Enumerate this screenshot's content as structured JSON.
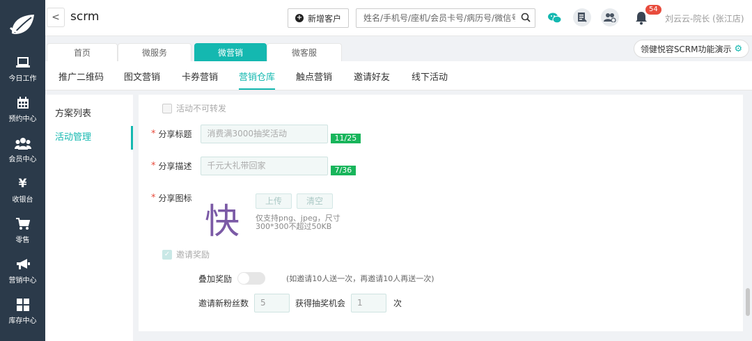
{
  "sidebar": {
    "logo_icon": "leaf-logo-icon",
    "items": [
      {
        "label": "今日工作",
        "icon": "laptop-icon"
      },
      {
        "label": "预约中心",
        "icon": "calendar-icon"
      },
      {
        "label": "会员中心",
        "icon": "users-icon"
      },
      {
        "label": "收银台",
        "icon": "yen-icon"
      },
      {
        "label": "零售",
        "icon": "cart-icon"
      },
      {
        "label": "营销中心",
        "icon": "megaphone-icon"
      },
      {
        "label": "库存中心",
        "icon": "grid-icon"
      }
    ]
  },
  "header": {
    "back": "<",
    "title": "scrm",
    "add_customer": "新增客户",
    "search_placeholder": "姓名/手机号/座机/会员卡号/病历号/微信号",
    "notification_count": "54",
    "user": "刘云云-院长 (张江店)"
  },
  "tabs": [
    {
      "label": "首页",
      "active": false
    },
    {
      "label": "微服务",
      "active": false
    },
    {
      "label": "微营销",
      "active": true
    },
    {
      "label": "微客服",
      "active": false
    }
  ],
  "demo_button": "领健悦容SCRM功能演示",
  "subnav": [
    {
      "label": "推广二维码",
      "active": false
    },
    {
      "label": "图文营销",
      "active": false
    },
    {
      "label": "卡券营销",
      "active": false
    },
    {
      "label": "营销仓库",
      "active": true
    },
    {
      "label": "触点营销",
      "active": false
    },
    {
      "label": "邀请好友",
      "active": false
    },
    {
      "label": "线下活动",
      "active": false
    }
  ],
  "left_menu": [
    {
      "label": "方案列表",
      "active": false
    },
    {
      "label": "活动管理",
      "active": true
    }
  ],
  "form": {
    "no_forward": "活动不可转发",
    "share_title_label": "分享标题",
    "share_title_value": "消费满3000抽奖活动",
    "share_title_count": "11/25",
    "share_desc_label": "分享描述",
    "share_desc_value": "千元大礼带回家",
    "share_desc_count": "7/36",
    "share_icon_label": "分享图标",
    "share_icon_char": "快",
    "upload_btn": "上传",
    "clear_btn": "清空",
    "icon_hint": "仅支持png、jpeg，尺寸300*300不超过50KB",
    "invite_reward": "邀请奖励",
    "stack_reward_label": "叠加奖励",
    "stack_reward_hint": "(如邀请10人送一次，再邀请10人再送一次)",
    "new_fans_label": "邀请新粉丝数",
    "new_fans_value": "5",
    "lottery_label": "获得抽奖机会",
    "lottery_value": "1",
    "lottery_unit": "次"
  },
  "colors": {
    "accent": "#14b8b0",
    "sidebar": "#2b3a4a",
    "badge": "#e84c3d",
    "counter": "#18b55b"
  }
}
